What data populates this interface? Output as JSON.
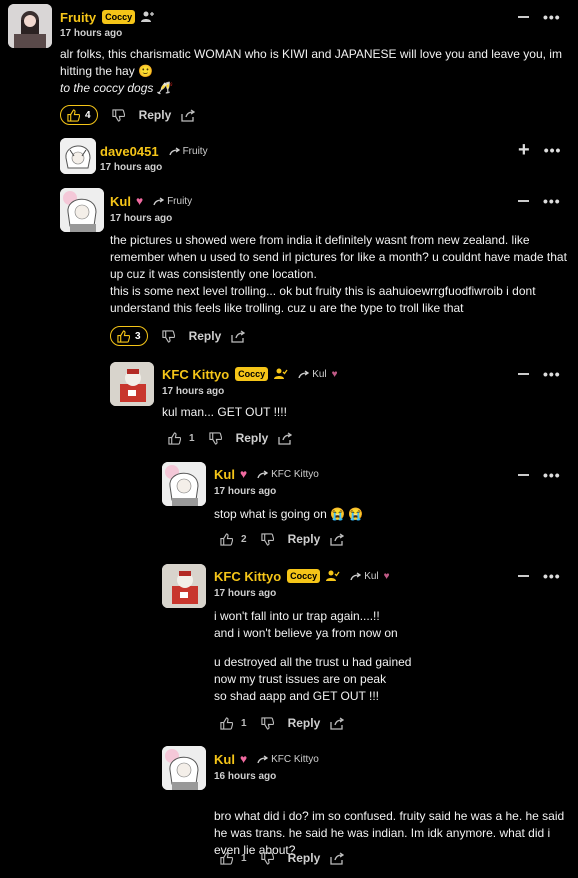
{
  "comments": [
    {
      "author": "Fruity",
      "badge": "Coccy",
      "time": "17 hours ago",
      "lines": [
        "alr folks, this charismatic WOMAN who is KIWI and JAPANESE will love you and leave you, im hitting the hay 🙂"
      ],
      "italic": "to the coccy dogs 🥂",
      "likes": "4",
      "reply_label": "Reply"
    },
    {
      "author": "dave0451",
      "reply_to": "Fruity",
      "time": "17 hours ago"
    },
    {
      "author": "Kul",
      "reply_to": "Fruity",
      "time": "17 hours ago",
      "lines": [
        "the pictures u showed were from india it definitely wasnt from new zealand. like remember when u used to send irl pictures for like a month? u couldnt have made that up cuz it was consistently one location.",
        "this is some next level trolling... ok but fruity this is aahuioewrrgfuodfiwroib i dont understand this feels like trolling. cuz u are the type to troll like that"
      ],
      "likes": "3",
      "reply_label": "Reply"
    },
    {
      "author": "KFC Kittyo",
      "badge": "Coccy",
      "reply_to": "Kul",
      "time": "17 hours ago",
      "lines": [
        "kul man... GET OUT !!!!"
      ],
      "likes": "1",
      "reply_label": "Reply"
    },
    {
      "author": "Kul",
      "reply_to": "KFC Kittyo",
      "time": "17 hours ago",
      "lines": [
        "stop what is going on 😭 😭"
      ],
      "likes": "2",
      "reply_label": "Reply"
    },
    {
      "author": "KFC Kittyo",
      "badge": "Coccy",
      "reply_to": "Kul",
      "time": "17 hours ago",
      "lines": [
        "i won't fall into ur trap again....!!",
        "and i won't believe ya from now on",
        "",
        "u destroyed all the trust u had gained",
        "now my trust issues are on peak",
        "so shad aapp and GET OUT !!!"
      ],
      "likes": "1",
      "reply_label": "Reply"
    },
    {
      "author": "Kul",
      "reply_to": "KFC Kittyo",
      "time": "16 hours ago",
      "lines": [
        "bro what did i do? im so confused. fruity said he was a he. he said he was trans. he said he was indian. Im idk anymore. what did i even lie about?"
      ],
      "likes": "1",
      "reply_label": "Reply"
    }
  ],
  "colors": {
    "accent": "#f5c518",
    "heart": "#f06aa0",
    "background": "#000000"
  },
  "icons": [
    "thumbs-up-icon",
    "thumbs-down-icon",
    "share-icon",
    "reply-arrow-icon",
    "more-icon",
    "collapse-icon",
    "expand-icon",
    "heart-icon",
    "user-badge-icon"
  ]
}
